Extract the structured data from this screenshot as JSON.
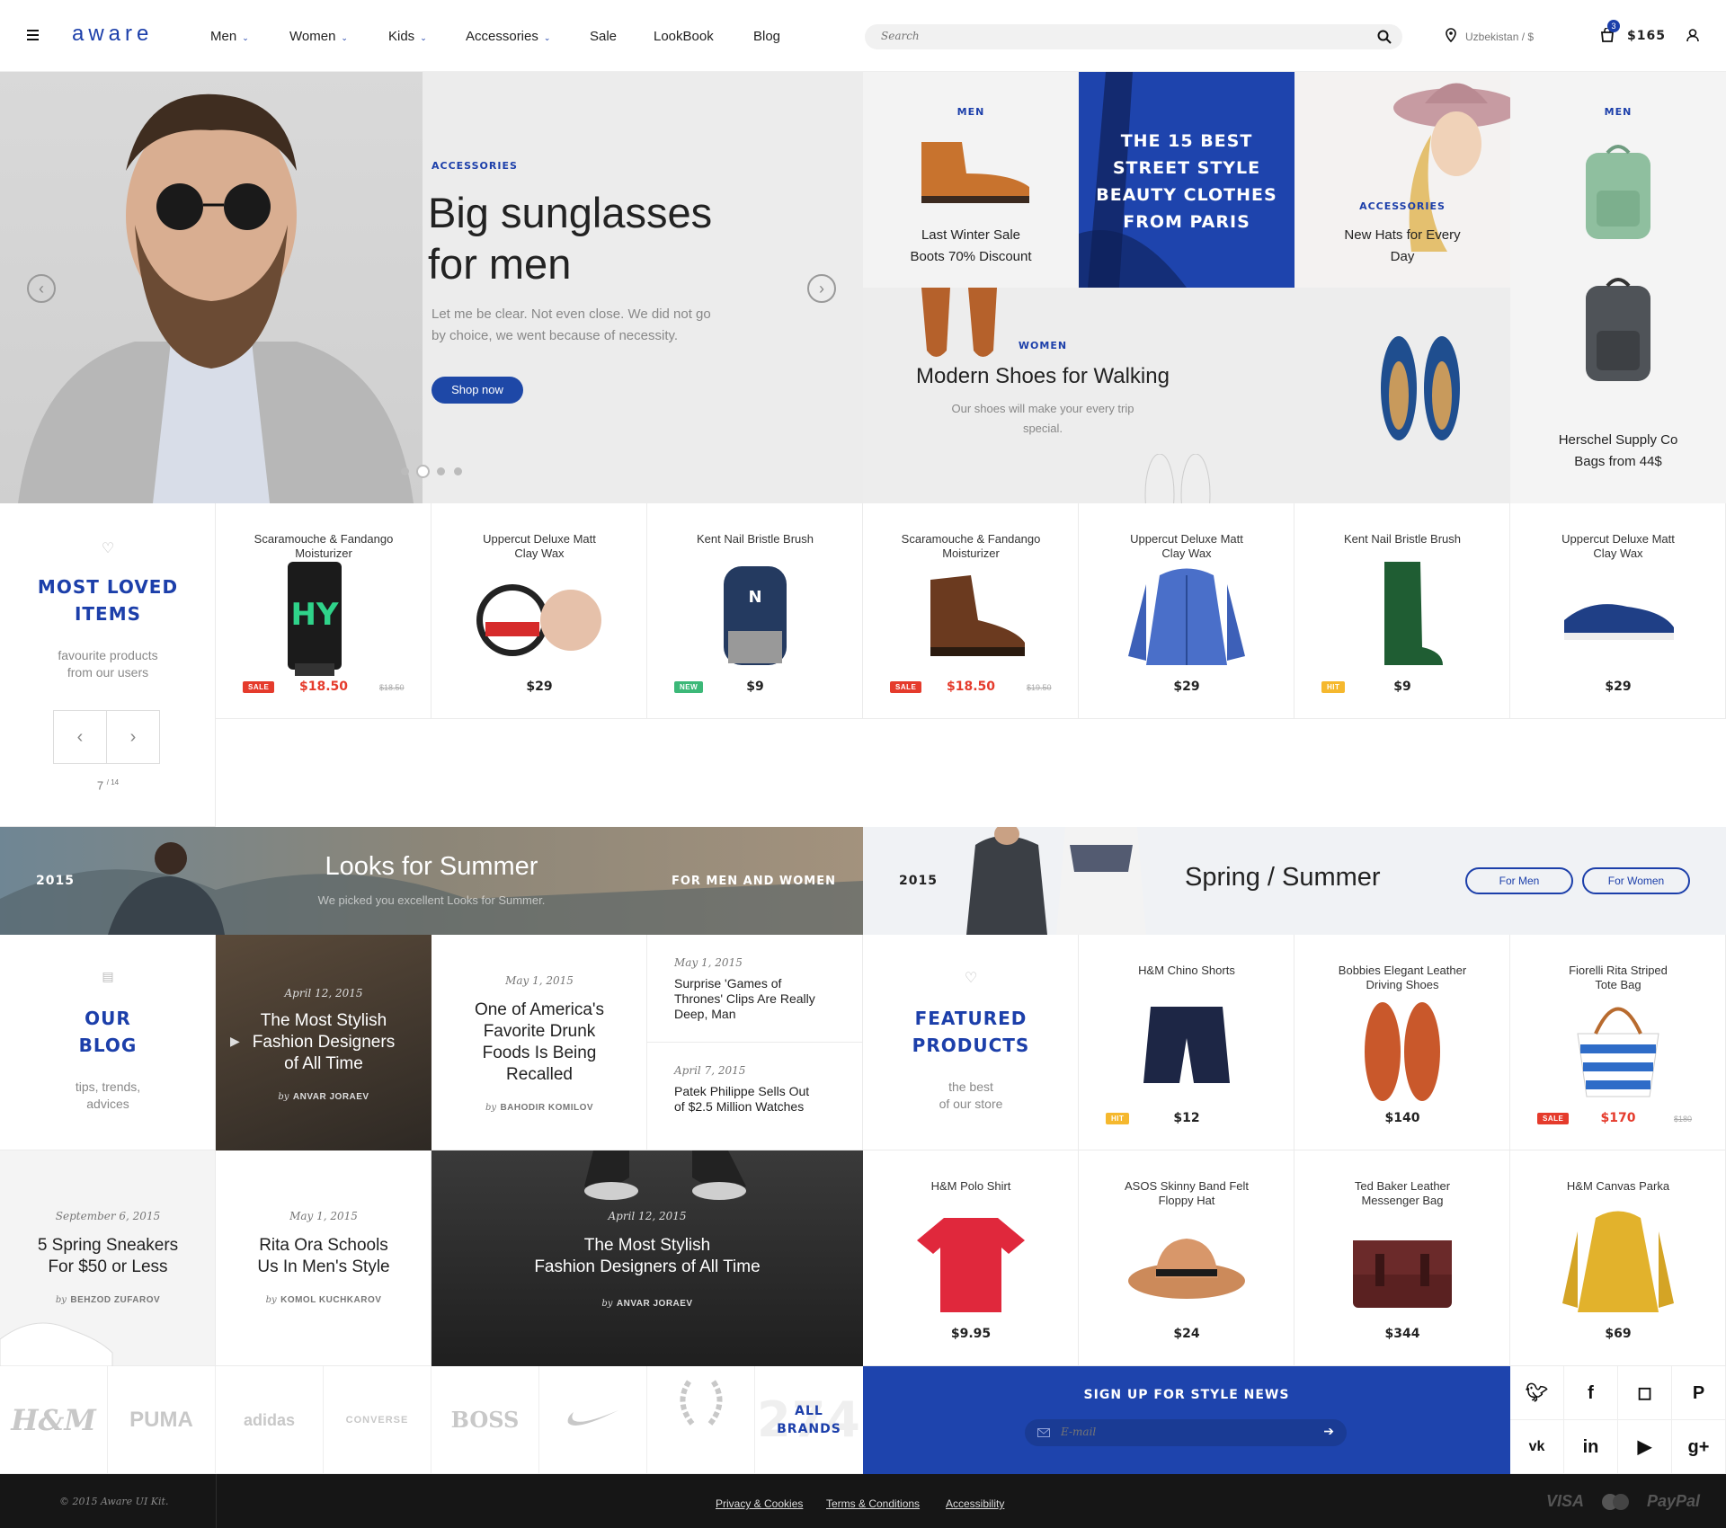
{
  "header": {
    "logo": "aware",
    "nav": [
      "Men",
      "Women",
      "Kids",
      "Accessories",
      "Sale",
      "LookBook",
      "Blog"
    ],
    "nav_dropdown": [
      true,
      true,
      true,
      true,
      false,
      false,
      false
    ],
    "search_placeholder": "Search",
    "location": "Uzbekistan / $",
    "cart_count": "3",
    "cart_total": "$165"
  },
  "hero": {
    "tag": "ACCESSORIES",
    "title_l1": "Big sunglasses",
    "title_l2": "for men",
    "desc_l1": "Let me be clear. Not even close. We did not go",
    "desc_l2": "by choice, we went because of necessity.",
    "cta": "Shop now"
  },
  "promos": {
    "men1": {
      "tag": "MEN",
      "l1": "Last Winter Sale",
      "l2": "Boots 70% Discount"
    },
    "street": {
      "l1": "THE 15 BEST",
      "l2": "STREET STYLE",
      "l3": "BEAUTY CLOTHES",
      "l4": "FROM PARIS"
    },
    "hats": {
      "tag": "ACCESSORIES",
      "l1": "New Hats for Every",
      "l2": "Day"
    },
    "men2": {
      "tag": "MEN",
      "l1": "Herschel Supply Co",
      "l2": "Bags from 44$"
    },
    "women": {
      "tag": "WOMEN",
      "title": "Modern Shoes for Walking",
      "l1": "Our shoes will make your every trip",
      "l2": "special."
    }
  },
  "loved": {
    "title_l1": "MOST LOVED",
    "title_l2": "ITEMS",
    "sub_l1": "favourite products",
    "sub_l2": "from our users",
    "page": "7",
    "total": "/ 14"
  },
  "loved_products": [
    {
      "name_l1": "Scaramouche & Fandango",
      "name_l2": "Moisturizer",
      "price": "$18.50",
      "old": "$18.50",
      "badge": "SALE",
      "badge_color": "#e53b2c"
    },
    {
      "name_l1": "Uppercut Deluxe Matt",
      "name_l2": "Clay Wax",
      "price": "$29",
      "old": "",
      "badge": "",
      "badge_color": ""
    },
    {
      "name_l1": "Kent Nail Bristle Brush",
      "name_l2": "",
      "price": "$9",
      "old": "",
      "badge": "NEW",
      "badge_color": "#3cb878"
    },
    {
      "name_l1": "Scaramouche & Fandango",
      "name_l2": "Moisturizer",
      "price": "$18.50",
      "old": "$19.50",
      "badge": "SALE",
      "badge_color": "#e53b2c"
    },
    {
      "name_l1": "Uppercut Deluxe Matt",
      "name_l2": "Clay Wax",
      "price": "$29",
      "old": "",
      "badge": "",
      "badge_color": ""
    },
    {
      "name_l1": "Kent Nail Bristle Brush",
      "name_l2": "",
      "price": "$9",
      "old": "",
      "badge": "HIT",
      "badge_color": "#f5b82e"
    },
    {
      "name_l1": "Uppercut Deluxe Matt",
      "name_l2": "Clay Wax",
      "price": "$29",
      "old": "",
      "badge": "",
      "badge_color": ""
    }
  ],
  "looks": {
    "year": "2015",
    "title": "Looks for Summer",
    "sub": "We picked you excellent Looks for Summer.",
    "right": "FOR MEN AND WOMEN"
  },
  "spring": {
    "year": "2015",
    "title": "Spring / Summer",
    "btn_men": "For Men",
    "btn_women": "For Women"
  },
  "blog": {
    "title_l1": "OUR",
    "title_l2": "BLOG",
    "sub_l1": "tips, trends,",
    "sub_l2": "advices"
  },
  "posts": {
    "p1": {
      "date": "April 12, 2015",
      "l1": "The Most Stylish",
      "l2": "Fashion Designers",
      "l3": "of All Time",
      "by": "by",
      "author": "ANVAR JORAEV"
    },
    "p2": {
      "date": "May 1, 2015",
      "l1": "One of America's",
      "l2": "Favorite Drunk",
      "l3": "Foods Is Being",
      "l4": "Recalled",
      "by": "by",
      "author": "BAHODIR KOMILOV"
    },
    "p3": {
      "date": "May 1, 2015",
      "l1": "Surprise 'Games of",
      "l2": "Thrones' Clips Are Really",
      "l3": "Deep, Man"
    },
    "p4": {
      "date": "April 7, 2015",
      "l1": "Patek Philippe Sells Out",
      "l2": "of $2.5 Million Watches"
    },
    "p5": {
      "date": "September 6, 2015",
      "l1": "5 Spring Sneakers",
      "l2": "For $50 or Less",
      "by": "by",
      "author": "BEHZOD ZUFAROV"
    },
    "p6": {
      "date": "May 1, 2015",
      "l1": "Rita Ora Schools",
      "l2": "Us In Men's Style",
      "by": "by",
      "author": "KOMOL KUCHKAROV"
    },
    "p7": {
      "date": "April 12, 2015",
      "l1": "The Most Stylish",
      "l2": "Fashion Designers of All Time",
      "by": "by",
      "author": "ANVAR JORAEV"
    }
  },
  "featured": {
    "title_l1": "FEATURED",
    "title_l2": "PRODUCTS",
    "sub_l1": "the best",
    "sub_l2": "of our store"
  },
  "featured_products": [
    {
      "name_l1": "H&M Chino Shorts",
      "name_l2": "",
      "price": "$12",
      "old": "",
      "badge": "HIT",
      "badge_color": "#f5b82e"
    },
    {
      "name_l1": "Bobbies Elegant Leather",
      "name_l2": "Driving Shoes",
      "price": "$140",
      "old": "",
      "badge": "",
      "badge_color": ""
    },
    {
      "name_l1": "Fiorelli Rita Striped",
      "name_l2": "Tote Bag",
      "price": "$170",
      "old": "$180",
      "badge": "SALE",
      "badge_color": "#e53b2c"
    },
    {
      "name_l1": "H&M Polo Shirt",
      "name_l2": "",
      "price": "$9.95",
      "old": "",
      "badge": "",
      "badge_color": ""
    },
    {
      "name_l1": "ASOS Skinny Band Felt",
      "name_l2": "Floppy Hat",
      "price": "$24",
      "old": "",
      "badge": "",
      "badge_color": ""
    },
    {
      "name_l1": "Ted Baker Leather",
      "name_l2": "Messenger Bag",
      "price": "$344",
      "old": "",
      "badge": "",
      "badge_color": ""
    },
    {
      "name_l1": "H&M Canvas Parka",
      "name_l2": "",
      "price": "$69",
      "old": "",
      "badge": "",
      "badge_color": ""
    }
  ],
  "brands": [
    "H&M",
    "PUMA",
    "adidas",
    "CONVERSE",
    "BOSS",
    "NIKE",
    "FRED PERRY"
  ],
  "all_brands": {
    "l1": "ALL",
    "l2": "BRANDS",
    "bg": "274"
  },
  "newsletter": {
    "title": "SIGN UP FOR STYLE NEWS",
    "placeholder": "E-mail"
  },
  "social": [
    "twitter",
    "facebook",
    "instagram",
    "pinterest",
    "vk",
    "linkedin",
    "youtube",
    "google-plus"
  ],
  "footer": {
    "copyright": "© 2015 Aware UI Kit.",
    "links": [
      "Privacy & Cookies",
      "Terms & Conditions",
      "Accessibility"
    ],
    "payments": [
      "VISA",
      "MasterCard",
      "PayPal"
    ]
  },
  "colors": {
    "accent": "#1c3faa",
    "sale": "#e53b2c",
    "new": "#3cb878",
    "hit": "#f5b82e",
    "footer": "#161616"
  }
}
